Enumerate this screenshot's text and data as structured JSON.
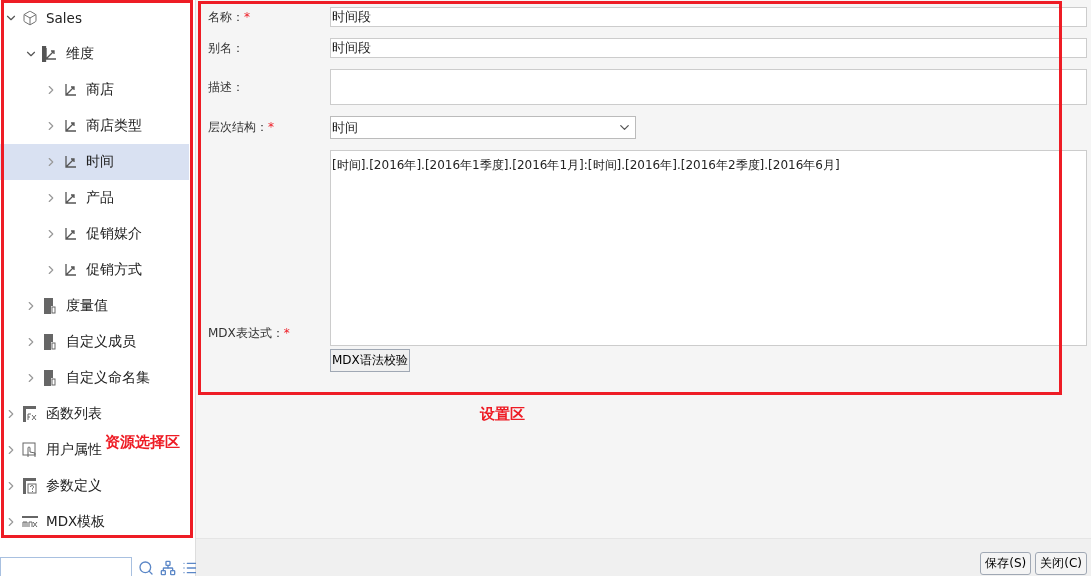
{
  "tree": [
    {
      "label": "Sales",
      "kind": "cube",
      "expanded": true,
      "selected": false,
      "children": [
        {
          "label": "维度",
          "kind": "dimension",
          "expanded": true,
          "selected": false,
          "children": [
            {
              "label": "商店",
              "kind": "hierarchy",
              "expanded": false,
              "selected": false
            },
            {
              "label": "商店类型",
              "kind": "hierarchy",
              "expanded": false,
              "selected": false
            },
            {
              "label": "时间",
              "kind": "hierarchy",
              "expanded": false,
              "selected": true
            },
            {
              "label": "产品",
              "kind": "hierarchy",
              "expanded": false,
              "selected": false
            },
            {
              "label": "促销媒介",
              "kind": "hierarchy",
              "expanded": false,
              "selected": false
            },
            {
              "label": "促销方式",
              "kind": "hierarchy",
              "expanded": false,
              "selected": false
            }
          ]
        },
        {
          "label": "度量值",
          "kind": "folder",
          "expanded": false,
          "selected": false
        },
        {
          "label": "自定义成员",
          "kind": "folder",
          "expanded": false,
          "selected": false
        },
        {
          "label": "自定义命名集",
          "kind": "folder",
          "expanded": false,
          "selected": false
        }
      ]
    },
    {
      "label": "函数列表",
      "kind": "function",
      "expanded": false,
      "selected": false
    },
    {
      "label": "用户属性",
      "kind": "user",
      "expanded": false,
      "selected": false
    },
    {
      "label": "参数定义",
      "kind": "param",
      "expanded": false,
      "selected": false
    },
    {
      "label": "MDX模板",
      "kind": "mdx",
      "expanded": false,
      "selected": false
    }
  ],
  "annotations": {
    "resource_area": "资源选择区",
    "settings_area": "设置区"
  },
  "form": {
    "fields": [
      {
        "label": "名称：",
        "required_mark": "*",
        "kind": "text",
        "value": "时间段"
      },
      {
        "label": "别名：",
        "kind": "text",
        "value": "时间段"
      },
      {
        "label": "描述：",
        "kind": "textarea"
      },
      {
        "label": "层次结构：",
        "required_mark": "*",
        "kind": "select",
        "value": "时间"
      },
      {
        "label": "MDX表达式：",
        "required_mark": "*",
        "kind": "mdx",
        "value": "[时间].[2016年].[2016年1季度].[2016年1月]:[时间].[2016年].[2016年2季度].[2016年6月]",
        "button": "MDX语法校验"
      }
    ]
  },
  "footer": {
    "buttons": [
      "保存(S)",
      "关闭(C)"
    ]
  }
}
